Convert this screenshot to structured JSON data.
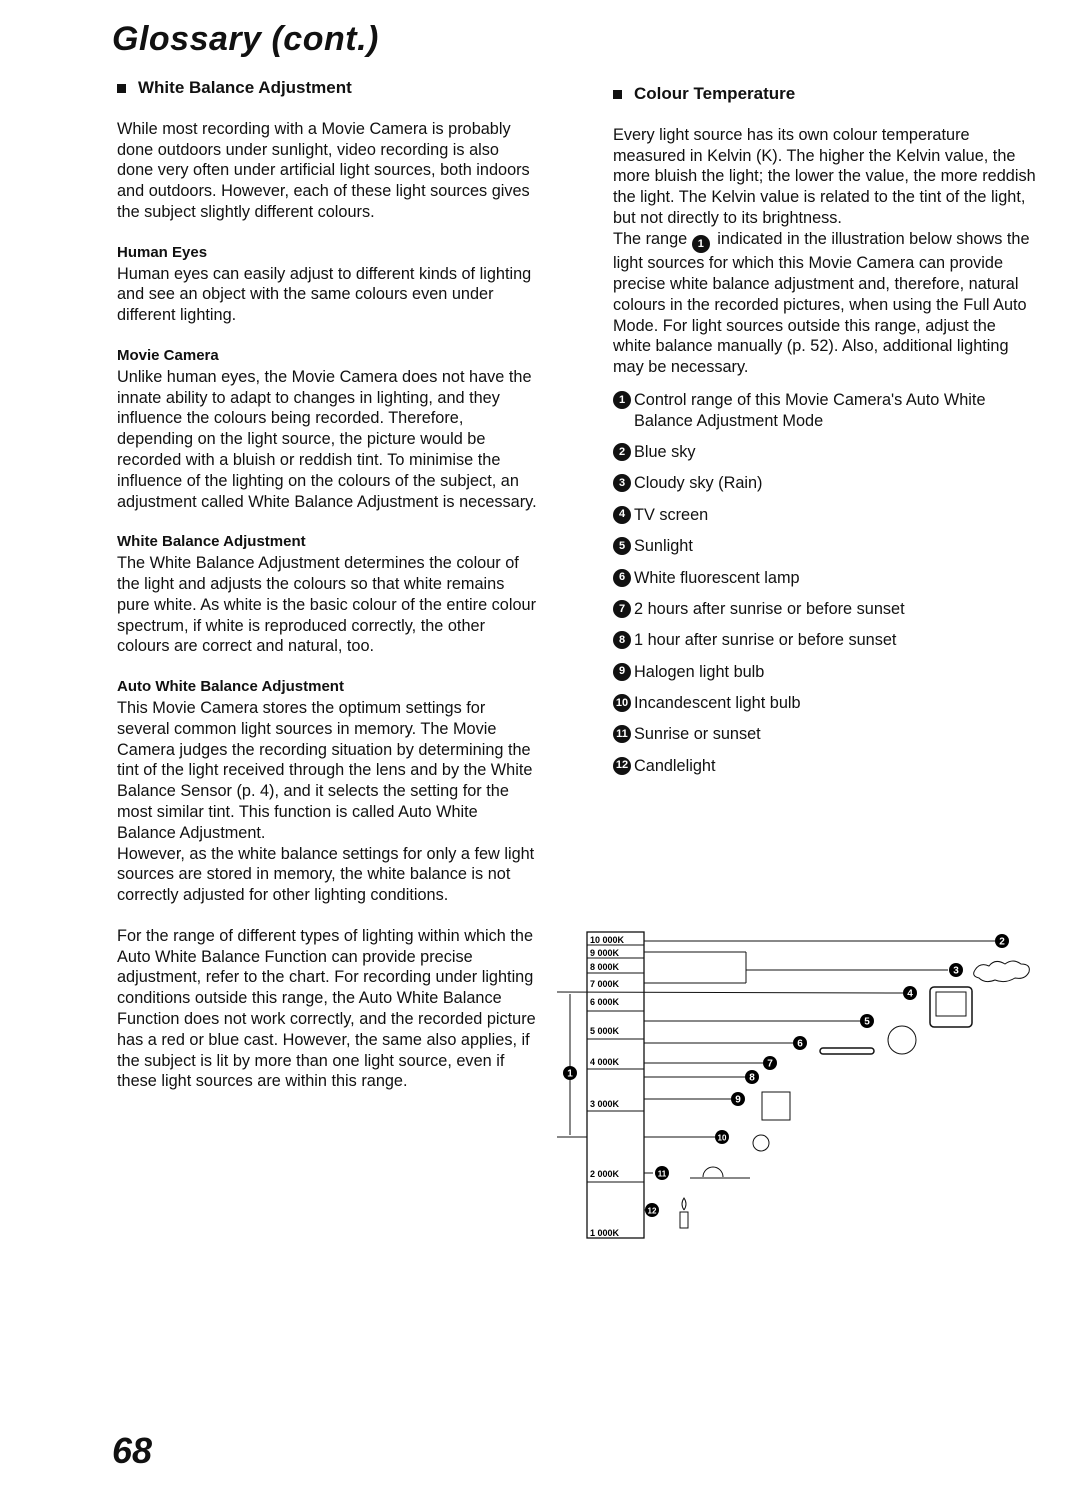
{
  "title": "Glossary (cont.)",
  "left": {
    "heading": "White Balance Adjustment",
    "intro": "While most recording with a Movie Camera is probably done outdoors under sunlight, video recording is also done very often under artificial light sources, both indoors and outdoors. However, each of these light sources gives the subject slightly different colours.",
    "sections": [
      {
        "title": "Human Eyes",
        "text": "Human eyes can easily adjust to different kinds of lighting and see an object with the same colours even under different lighting."
      },
      {
        "title": "Movie Camera",
        "text": "Unlike human eyes, the Movie Camera does not have the innate ability to adapt to changes in lighting, and they influence the colours being recorded. Therefore, depending on the light source, the picture would be recorded with a bluish or reddish tint. To minimise the influence of the lighting on the colours of the subject, an adjustment called White Balance Adjustment is necessary."
      },
      {
        "title": "White Balance Adjustment",
        "text": "The White Balance Adjustment determines the colour of the light and adjusts the colours so that white remains pure white. As white is the basic colour of the entire colour spectrum, if white is reproduced correctly, the other colours are correct and natural, too."
      },
      {
        "title": "Auto White Balance Adjustment",
        "text": "This Movie Camera stores the optimum settings for several common light sources in memory. The Movie Camera judges the recording situation by determining the tint of the light received through the lens and by the White Balance Sensor (p. 4), and it selects the setting for the most similar tint. This function is called Auto White Balance Adjustment.",
        "text2": "However, as the white balance settings for only a few light sources are stored in memory, the white balance is not correctly adjusted for other lighting conditions."
      }
    ],
    "closing": "For the range of different types of lighting within which the Auto White Balance Function can provide precise adjustment, refer to the chart. For recording under lighting conditions outside this range, the Auto White Balance Function does not work correctly, and the recorded picture has a red or blue cast. However, the same also applies, if the subject is lit by more than one light source, even if these light sources are within this range."
  },
  "right": {
    "heading": "Colour Temperature",
    "p1": "Every light source has its own colour temperature measured in Kelvin (K). The higher the Kelvin value, the more bluish the light; the lower the value, the more reddish the light. The Kelvin value is related to the tint of the light, but not directly to its brightness.",
    "p2a": "The range",
    "p2num": "1",
    "p2b": "indicated in the illustration below shows the light sources for which this Movie Camera can provide precise white balance adjustment and, therefore, natural colours in the recorded pictures, when using the Full Auto Mode. For light sources outside this range, adjust the white balance manually (p. 52). Also, additional lighting may be necessary.",
    "items": [
      {
        "num": "1",
        "label": "Control range of this Movie Camera's Auto White Balance Adjustment Mode"
      },
      {
        "num": "2",
        "label": "Blue sky"
      },
      {
        "num": "3",
        "label": "Cloudy sky (Rain)"
      },
      {
        "num": "4",
        "label": "TV screen"
      },
      {
        "num": "5",
        "label": "Sunlight"
      },
      {
        "num": "6",
        "label": "White fluorescent lamp"
      },
      {
        "num": "7",
        "label": "2 hours after sunrise or before sunset"
      },
      {
        "num": "8",
        "label": "1 hour after sunrise or before sunset"
      },
      {
        "num": "9",
        "label": "Halogen light bulb"
      },
      {
        "num": "10",
        "label": "Incandescent light bulb"
      },
      {
        "num": "11",
        "label": "Sunrise or sunset"
      },
      {
        "num": "12",
        "label": "Candlelight"
      }
    ]
  },
  "diagram": {
    "scale": [
      "10 000K",
      "9 000K",
      "8 000K",
      "7 000K",
      "6 000K",
      "5 000K",
      "4 000K",
      "3 000K",
      "2 000K",
      "1 000K"
    ],
    "markers": [
      "1",
      "2",
      "3",
      "4",
      "5",
      "6",
      "7",
      "8",
      "9",
      "10",
      "11",
      "12"
    ]
  },
  "page_number": "68"
}
